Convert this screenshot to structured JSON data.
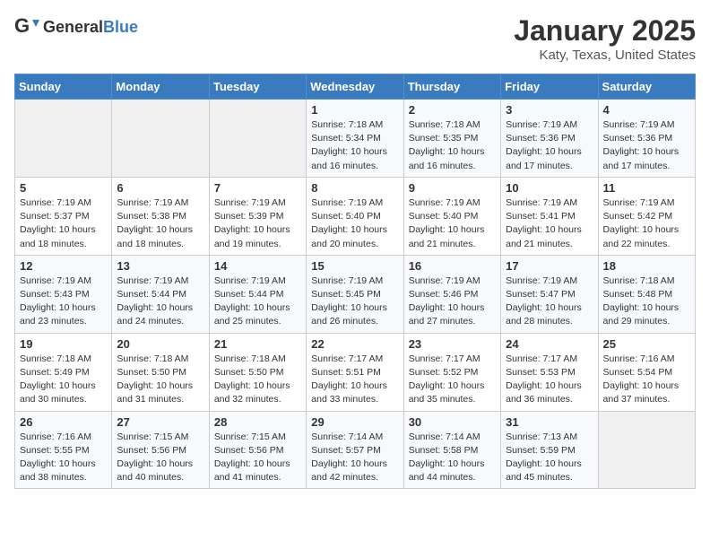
{
  "header": {
    "logo_general": "General",
    "logo_blue": "Blue",
    "title": "January 2025",
    "subtitle": "Katy, Texas, United States"
  },
  "days_of_week": [
    "Sunday",
    "Monday",
    "Tuesday",
    "Wednesday",
    "Thursday",
    "Friday",
    "Saturday"
  ],
  "weeks": [
    [
      {
        "day": "",
        "sunrise": "",
        "sunset": "",
        "daylight": ""
      },
      {
        "day": "",
        "sunrise": "",
        "sunset": "",
        "daylight": ""
      },
      {
        "day": "",
        "sunrise": "",
        "sunset": "",
        "daylight": ""
      },
      {
        "day": "1",
        "sunrise": "Sunrise: 7:18 AM",
        "sunset": "Sunset: 5:34 PM",
        "daylight": "Daylight: 10 hours and 16 minutes."
      },
      {
        "day": "2",
        "sunrise": "Sunrise: 7:18 AM",
        "sunset": "Sunset: 5:35 PM",
        "daylight": "Daylight: 10 hours and 16 minutes."
      },
      {
        "day": "3",
        "sunrise": "Sunrise: 7:19 AM",
        "sunset": "Sunset: 5:36 PM",
        "daylight": "Daylight: 10 hours and 17 minutes."
      },
      {
        "day": "4",
        "sunrise": "Sunrise: 7:19 AM",
        "sunset": "Sunset: 5:36 PM",
        "daylight": "Daylight: 10 hours and 17 minutes."
      }
    ],
    [
      {
        "day": "5",
        "sunrise": "Sunrise: 7:19 AM",
        "sunset": "Sunset: 5:37 PM",
        "daylight": "Daylight: 10 hours and 18 minutes."
      },
      {
        "day": "6",
        "sunrise": "Sunrise: 7:19 AM",
        "sunset": "Sunset: 5:38 PM",
        "daylight": "Daylight: 10 hours and 18 minutes."
      },
      {
        "day": "7",
        "sunrise": "Sunrise: 7:19 AM",
        "sunset": "Sunset: 5:39 PM",
        "daylight": "Daylight: 10 hours and 19 minutes."
      },
      {
        "day": "8",
        "sunrise": "Sunrise: 7:19 AM",
        "sunset": "Sunset: 5:40 PM",
        "daylight": "Daylight: 10 hours and 20 minutes."
      },
      {
        "day": "9",
        "sunrise": "Sunrise: 7:19 AM",
        "sunset": "Sunset: 5:40 PM",
        "daylight": "Daylight: 10 hours and 21 minutes."
      },
      {
        "day": "10",
        "sunrise": "Sunrise: 7:19 AM",
        "sunset": "Sunset: 5:41 PM",
        "daylight": "Daylight: 10 hours and 21 minutes."
      },
      {
        "day": "11",
        "sunrise": "Sunrise: 7:19 AM",
        "sunset": "Sunset: 5:42 PM",
        "daylight": "Daylight: 10 hours and 22 minutes."
      }
    ],
    [
      {
        "day": "12",
        "sunrise": "Sunrise: 7:19 AM",
        "sunset": "Sunset: 5:43 PM",
        "daylight": "Daylight: 10 hours and 23 minutes."
      },
      {
        "day": "13",
        "sunrise": "Sunrise: 7:19 AM",
        "sunset": "Sunset: 5:44 PM",
        "daylight": "Daylight: 10 hours and 24 minutes."
      },
      {
        "day": "14",
        "sunrise": "Sunrise: 7:19 AM",
        "sunset": "Sunset: 5:44 PM",
        "daylight": "Daylight: 10 hours and 25 minutes."
      },
      {
        "day": "15",
        "sunrise": "Sunrise: 7:19 AM",
        "sunset": "Sunset: 5:45 PM",
        "daylight": "Daylight: 10 hours and 26 minutes."
      },
      {
        "day": "16",
        "sunrise": "Sunrise: 7:19 AM",
        "sunset": "Sunset: 5:46 PM",
        "daylight": "Daylight: 10 hours and 27 minutes."
      },
      {
        "day": "17",
        "sunrise": "Sunrise: 7:19 AM",
        "sunset": "Sunset: 5:47 PM",
        "daylight": "Daylight: 10 hours and 28 minutes."
      },
      {
        "day": "18",
        "sunrise": "Sunrise: 7:18 AM",
        "sunset": "Sunset: 5:48 PM",
        "daylight": "Daylight: 10 hours and 29 minutes."
      }
    ],
    [
      {
        "day": "19",
        "sunrise": "Sunrise: 7:18 AM",
        "sunset": "Sunset: 5:49 PM",
        "daylight": "Daylight: 10 hours and 30 minutes."
      },
      {
        "day": "20",
        "sunrise": "Sunrise: 7:18 AM",
        "sunset": "Sunset: 5:50 PM",
        "daylight": "Daylight: 10 hours and 31 minutes."
      },
      {
        "day": "21",
        "sunrise": "Sunrise: 7:18 AM",
        "sunset": "Sunset: 5:50 PM",
        "daylight": "Daylight: 10 hours and 32 minutes."
      },
      {
        "day": "22",
        "sunrise": "Sunrise: 7:17 AM",
        "sunset": "Sunset: 5:51 PM",
        "daylight": "Daylight: 10 hours and 33 minutes."
      },
      {
        "day": "23",
        "sunrise": "Sunrise: 7:17 AM",
        "sunset": "Sunset: 5:52 PM",
        "daylight": "Daylight: 10 hours and 35 minutes."
      },
      {
        "day": "24",
        "sunrise": "Sunrise: 7:17 AM",
        "sunset": "Sunset: 5:53 PM",
        "daylight": "Daylight: 10 hours and 36 minutes."
      },
      {
        "day": "25",
        "sunrise": "Sunrise: 7:16 AM",
        "sunset": "Sunset: 5:54 PM",
        "daylight": "Daylight: 10 hours and 37 minutes."
      }
    ],
    [
      {
        "day": "26",
        "sunrise": "Sunrise: 7:16 AM",
        "sunset": "Sunset: 5:55 PM",
        "daylight": "Daylight: 10 hours and 38 minutes."
      },
      {
        "day": "27",
        "sunrise": "Sunrise: 7:15 AM",
        "sunset": "Sunset: 5:56 PM",
        "daylight": "Daylight: 10 hours and 40 minutes."
      },
      {
        "day": "28",
        "sunrise": "Sunrise: 7:15 AM",
        "sunset": "Sunset: 5:56 PM",
        "daylight": "Daylight: 10 hours and 41 minutes."
      },
      {
        "day": "29",
        "sunrise": "Sunrise: 7:14 AM",
        "sunset": "Sunset: 5:57 PM",
        "daylight": "Daylight: 10 hours and 42 minutes."
      },
      {
        "day": "30",
        "sunrise": "Sunrise: 7:14 AM",
        "sunset": "Sunset: 5:58 PM",
        "daylight": "Daylight: 10 hours and 44 minutes."
      },
      {
        "day": "31",
        "sunrise": "Sunrise: 7:13 AM",
        "sunset": "Sunset: 5:59 PM",
        "daylight": "Daylight: 10 hours and 45 minutes."
      },
      {
        "day": "",
        "sunrise": "",
        "sunset": "",
        "daylight": ""
      }
    ]
  ]
}
